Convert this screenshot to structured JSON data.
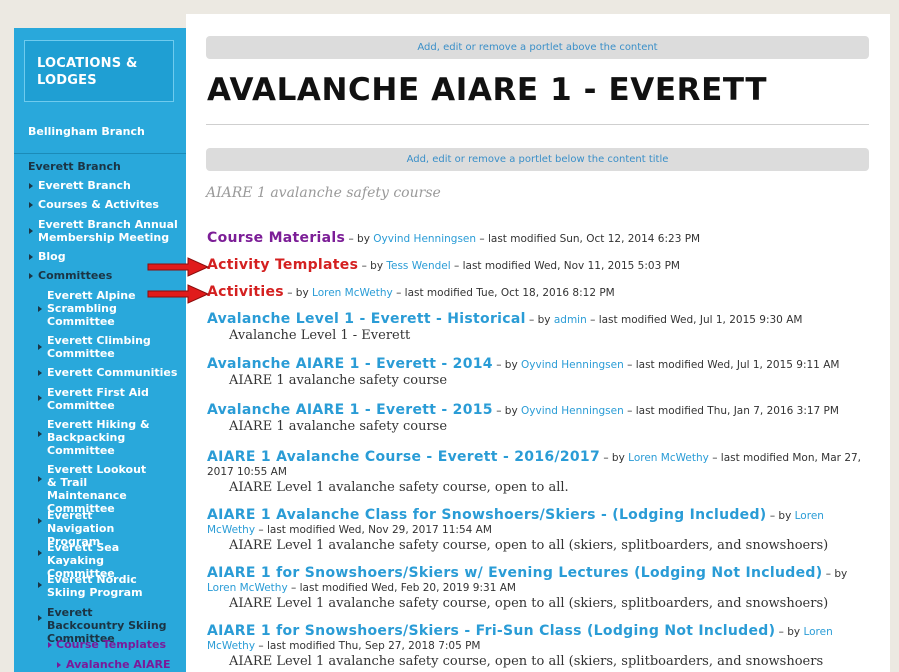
{
  "sidebar": {
    "header": "LOCATIONS & LODGES",
    "top_link": "Bellingham Branch",
    "branch_title": "Everett Branch",
    "items": [
      {
        "label": "Everett Branch"
      },
      {
        "label": "Courses & Activites"
      },
      {
        "label": "Everett Branch Annual Membership Meeting"
      },
      {
        "label": "Blog"
      },
      {
        "label": "Committees"
      }
    ],
    "committees": [
      {
        "label": "Everett Alpine Scrambling Committee"
      },
      {
        "label": "Everett Climbing Committee"
      },
      {
        "label": "Everett Communities"
      },
      {
        "label": "Everett First Aid Committee"
      },
      {
        "label": "Everett Hiking & Backpacking Committee"
      },
      {
        "label": "Everett Lookout & Trail Maintenance Committee"
      },
      {
        "label": "Everett Navigation Program"
      },
      {
        "label": "Everett Sea Kayaking Committee"
      },
      {
        "label": "Everett Nordic Skiing Program"
      },
      {
        "label": "Everett Backcountry Skiing Committee"
      }
    ],
    "sub_course_templates": "Course Templates",
    "sub_current": "Avalanche AIARE"
  },
  "portlets": {
    "above_content": "Add, edit or remove a portlet above the content",
    "below_title": "Add, edit or remove a portlet below the content title"
  },
  "page": {
    "title": "AVALANCHE AIARE 1 - EVERETT",
    "description": "AIARE 1 avalanche safety course"
  },
  "entries": [
    {
      "title": "Course Materials",
      "by": "– by",
      "author": "Oyvind Henningsen",
      "modified": "– last modified Sun, Oct 12, 2014 6:23 PM",
      "desc": ""
    },
    {
      "title": "Activity Templates",
      "by": "– by",
      "author": "Tess Wendel",
      "modified": "– last modified Wed, Nov 11, 2015 5:03 PM",
      "desc": ""
    },
    {
      "title": "Activities",
      "by": "– by",
      "author": "Loren McWethy",
      "modified": "– last modified Tue, Oct 18, 2016 8:12 PM",
      "desc": ""
    },
    {
      "title": "Avalanche Level 1 - Everett - Historical",
      "by": "– by",
      "author": "admin",
      "modified": "– last modified Wed, Jul 1, 2015 9:30 AM",
      "desc": "Avalanche Level 1 - Everett"
    },
    {
      "title": "Avalanche AIARE 1 - Everett - 2014",
      "by": "– by",
      "author": "Oyvind Henningsen",
      "modified": "– last modified Wed, Jul 1, 2015 9:11 AM",
      "desc": "AIARE 1 avalanche safety course"
    },
    {
      "title": "Avalanche AIARE 1 - Everett - 2015",
      "by": "– by",
      "author": "Oyvind Henningsen",
      "modified": "– last modified Thu, Jan 7, 2016 3:17 PM",
      "desc": "AIARE 1 avalanche safety course"
    },
    {
      "title": "AIARE 1 Avalanche Course - Everett - 2016/2017",
      "by": "– by",
      "author": "Loren McWethy",
      "modified": "– last modified Mon, Mar 27, 2017 10:55 AM",
      "desc": "AIARE Level 1 avalanche safety course, open to all."
    },
    {
      "title": "AIARE 1 Avalanche Class for Snowshoers/Skiers - (Lodging Included)",
      "by": "– by",
      "author": "Loren McWethy",
      "modified": "– last modified Wed, Nov 29, 2017 11:54 AM",
      "desc": "AIARE Level 1 avalanche safety course, open to all (skiers, splitboarders, and snowshoers)"
    },
    {
      "title": "AIARE 1 for Snowshoers/Skiers w/ Evening Lectures (Lodging Not Included)",
      "by": "– by",
      "author": "Loren McWethy",
      "modified": "– last modified Wed, Feb 20, 2019 9:31 AM",
      "desc": "AIARE Level 1 avalanche safety course, open to all (skiers, splitboarders, and snowshoers)"
    },
    {
      "title": "AIARE 1 for Snowshoers/Skiers - Fri-Sun Class (Lodging Not Included)",
      "by": "– by",
      "author": "Loren McWethy",
      "modified": "– last modified Thu, Sep 27, 2018 7:05 PM",
      "desc": "AIARE Level 1 avalanche safety course, open to all (skiers, splitboarders, and snowshoers"
    }
  ],
  "colors": {
    "sidebar_bg": "#29a8db",
    "link_blue": "#2a9cd6",
    "folder_purple": "#7c1e97",
    "annotated_red": "#d42020"
  }
}
